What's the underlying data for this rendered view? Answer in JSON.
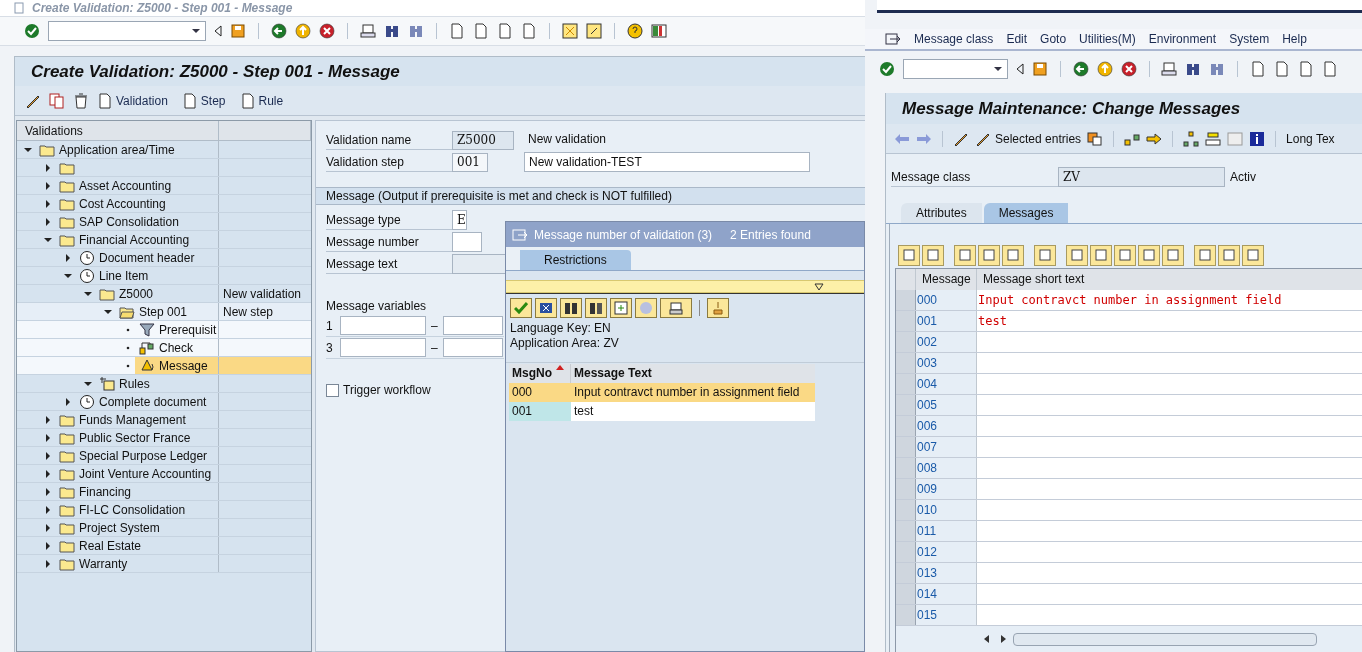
{
  "main_window": {
    "title": "Create Validation: Z5000 - Step 001 - Message",
    "screen_title": "Create Validation: Z5000 - Step 001 - Message",
    "app_toolbar": [
      {
        "label": "Validation"
      },
      {
        "label": "Step"
      },
      {
        "label": "Rule"
      }
    ],
    "tree": {
      "header": "Validations",
      "rows": [
        {
          "label": "Application area/Time",
          "kind": "folder",
          "expanded": true,
          "selected": false,
          "children": [
            {
              "kind": "folder",
              "expanded": false,
              "selected": false
            },
            {
              "label": "Asset Accounting",
              "kind": "folder",
              "expanded": false,
              "selected": false
            },
            {
              "label": "Cost Accounting",
              "kind": "folder",
              "expanded": false,
              "selected": false
            },
            {
              "label": "SAP Consolidation",
              "kind": "folder",
              "expanded": false,
              "selected": false
            },
            {
              "label": "Financial Accounting",
              "kind": "folder",
              "expanded": true,
              "selected": false,
              "children": [
                {
                  "label": "Document header",
                  "kind": "event",
                  "expanded": false,
                  "selected": false
                },
                {
                  "label": "Line Item",
                  "kind": "event",
                  "expanded": true,
                  "selected": false,
                  "children": [
                    {
                      "label": "Z5000",
                      "note": "New validation",
                      "kind": "folder",
                      "expanded": true,
                      "selected": false,
                      "children": [
                        {
                          "label": "Step 001",
                          "note": "New step",
                          "kind": "step",
                          "expanded": true,
                          "selected": false,
                          "children": [
                            {
                              "label": "Prerequisit",
                              "kind": "prerequisite",
                              "selected": false
                            },
                            {
                              "label": "Check",
                              "kind": "check",
                              "selected": false
                            },
                            {
                              "label": "Message",
                              "kind": "message",
                              "selected": true
                            }
                          ]
                        }
                      ]
                    },
                    {
                      "label": "Rules",
                      "kind": "rules",
                      "expanded": true,
                      "selected": false
                    }
                  ]
                },
                {
                  "label": "Complete document",
                  "kind": "event",
                  "expanded": false,
                  "selected": false
                }
              ]
            },
            {
              "label": "Funds Management",
              "kind": "folder",
              "expanded": false,
              "selected": false
            },
            {
              "label": "Public Sector France",
              "kind": "folder",
              "expanded": false,
              "selected": false
            },
            {
              "label": "Special Purpose Ledger",
              "kind": "folder",
              "expanded": false,
              "selected": false
            },
            {
              "label": "Joint Venture Accounting",
              "kind": "folder",
              "expanded": false,
              "selected": false
            },
            {
              "label": "Financing",
              "kind": "folder",
              "expanded": false,
              "selected": false
            },
            {
              "label": "FI-LC Consolidation",
              "kind": "folder",
              "expanded": false,
              "selected": false
            },
            {
              "label": "Project System",
              "kind": "folder",
              "expanded": false,
              "selected": false
            },
            {
              "label": "Real Estate",
              "kind": "folder",
              "expanded": false,
              "selected": false
            },
            {
              "label": "Warranty",
              "kind": "folder",
              "expanded": false,
              "selected": false
            }
          ]
        }
      ]
    },
    "header_fields": [
      {
        "label": "Validation name",
        "value": "Z5000",
        "description": "New validation",
        "editable": false
      },
      {
        "label": "Validation step",
        "value": "001",
        "description": "New validation-TEST",
        "editable": true
      }
    ],
    "message_group": {
      "title": "Message (Output if prerequisite is met and check is NOT fulfilled)",
      "fields": [
        {
          "label": "Message type",
          "value": "E"
        },
        {
          "label": "Message number"
        },
        {
          "label": "Message text"
        }
      ],
      "variables_label": "Message variables",
      "variable_rows": [
        {
          "index": "1",
          "separator": "–"
        },
        {
          "index": "3",
          "separator": "–"
        }
      ],
      "trigger_workflow": {
        "label": "Trigger workflow",
        "checked": false
      }
    }
  },
  "popup": {
    "title": "Message number of validation (3)",
    "count": "2 Entries found",
    "tabs": [
      {
        "label": "Restrictions",
        "selected": true
      }
    ],
    "info": [
      "Language Key: EN",
      "Application Area: ZV"
    ],
    "columns": [
      "MsgNo",
      "Message Text"
    ],
    "rows": [
      {
        "msgno": "000",
        "text": "Input contravct number in assignment field",
        "selected": true
      },
      {
        "msgno": "001",
        "text": "test",
        "selected": false
      }
    ]
  },
  "message_window": {
    "menu": [
      "Message class",
      "Edit",
      "Goto",
      "Utilities(M)",
      "Environment",
      "System",
      "Help"
    ],
    "screen_title": "Message Maintenance: Change Messages",
    "toolbar": {
      "selected_entries": "Selected entries",
      "long_text": "Long Tex"
    },
    "message_class": {
      "label": "Message class",
      "value": "ZV",
      "status": "Activ"
    },
    "tabs": [
      {
        "label": "Attributes",
        "selected": false
      },
      {
        "label": "Messages",
        "selected": true
      }
    ],
    "columns": [
      "Message",
      "Message short text"
    ],
    "rows": [
      {
        "number": "000",
        "text": "Input contravct number in assignment field"
      },
      {
        "number": "001",
        "text": "test"
      },
      {
        "number": "002"
      },
      {
        "number": "003"
      },
      {
        "number": "004"
      },
      {
        "number": "005"
      },
      {
        "number": "006"
      },
      {
        "number": "007"
      },
      {
        "number": "008"
      },
      {
        "number": "009"
      },
      {
        "number": "010"
      },
      {
        "number": "011"
      },
      {
        "number": "012"
      },
      {
        "number": "013"
      },
      {
        "number": "014"
      },
      {
        "number": "015"
      }
    ]
  }
}
